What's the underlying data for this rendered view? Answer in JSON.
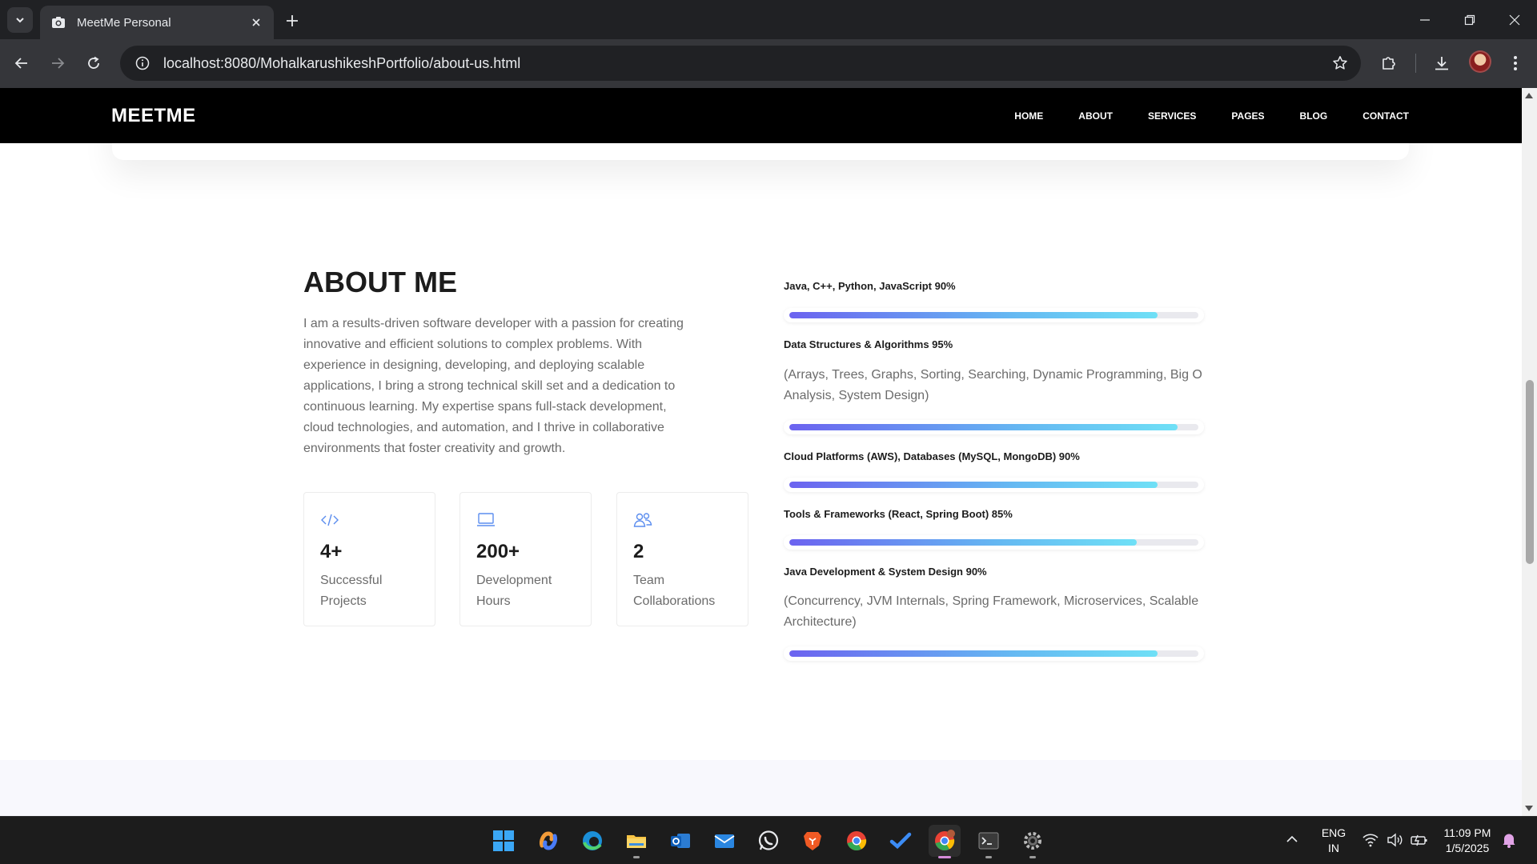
{
  "browser": {
    "tab_title": "MeetMe Personal",
    "url": "localhost:8080/MohalkarushikeshPortfolio/about-us.html"
  },
  "site": {
    "brand": "MEETME",
    "nav": [
      "HOME",
      "ABOUT",
      "SERVICES",
      "PAGES",
      "BLOG",
      "CONTACT"
    ]
  },
  "about": {
    "title": "ABOUT ME",
    "text": "I am a results-driven software developer with a passion for creating innovative and efficient solutions to complex problems. With experience in designing, developing, and deploying scalable applications, I bring a strong technical skill set and a dedication to continuous learning. My expertise spans full-stack development, cloud technologies, and automation, and I thrive in collaborative environments that foster creativity and growth.",
    "stats": [
      {
        "icon": "code-icon",
        "number": "4+",
        "label": "Successful Projects"
      },
      {
        "icon": "laptop-icon",
        "number": "200+",
        "label": "Development Hours"
      },
      {
        "icon": "team-icon",
        "number": "2",
        "label": "Team Collaborations"
      }
    ]
  },
  "skills": [
    {
      "title": "Java, C++, Python, JavaScript 90%",
      "description": "",
      "percent": 90
    },
    {
      "title": "Data Structures & Algorithms 95%",
      "description": "(Arrays, Trees, Graphs, Sorting, Searching, Dynamic Programming, Big O Analysis, System Design)",
      "percent": 95
    },
    {
      "title": "Cloud Platforms (AWS), Databases (MySQL, MongoDB) 90%",
      "description": "",
      "percent": 90
    },
    {
      "title": "Tools & Frameworks (React, Spring Boot) 85%",
      "description": "",
      "percent": 85
    },
    {
      "title": "Java Development & System Design 90%",
      "description": "(Concurrency, JVM Internals, Spring Framework, Microservices, Scalable Architecture)",
      "percent": 90
    }
  ],
  "taskbar": {
    "language_top": "ENG",
    "language_bottom": "IN",
    "time": "11:09 PM",
    "date": "1/5/2025"
  },
  "colors": {
    "accent_gradient_start": "#6c63f0",
    "accent_gradient_end": "#6fe0f6",
    "header_bg": "#000000",
    "icon_blue": "#5b8def"
  }
}
